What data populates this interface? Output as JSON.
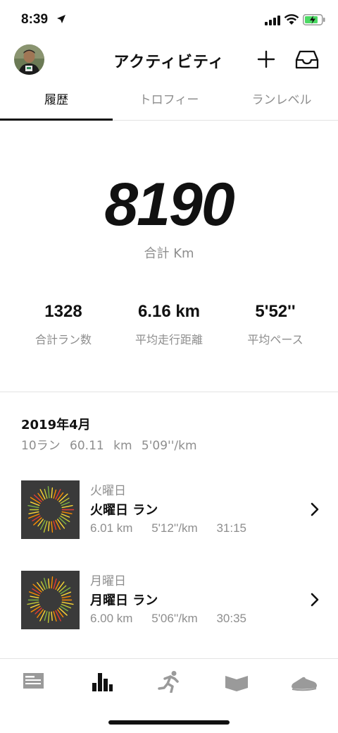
{
  "status": {
    "time": "8:39"
  },
  "header": {
    "title": "アクティビティ"
  },
  "tabs": [
    {
      "label": "履歴"
    },
    {
      "label": "トロフィー"
    },
    {
      "label": "ランレベル"
    }
  ],
  "summary": {
    "total_km": "8190",
    "total_label": "合計 Km",
    "stats": [
      {
        "value": "1328",
        "label": "合計ラン数"
      },
      {
        "value": "6.16 km",
        "label": "平均走行距離"
      },
      {
        "value": "5'52''",
        "label": "平均ペース"
      }
    ]
  },
  "month": {
    "title": "2019年4月",
    "summary": "10ラン 60.11 km 5'09''/km"
  },
  "runs": [
    {
      "day": "火曜日",
      "name": "火曜日 ラン",
      "distance": "6.01 km",
      "pace": "5'12''/km",
      "duration": "31:15"
    },
    {
      "day": "月曜日",
      "name": "月曜日 ラン",
      "distance": "6.00 km",
      "pace": "5'06''/km",
      "duration": "30:35"
    }
  ],
  "tabbar": {
    "items": [
      "feed-icon",
      "activity-chart-icon",
      "runner-icon",
      "plans-icon",
      "shoe-icon"
    ],
    "active": "activity-chart-icon"
  },
  "colors": {
    "inactive": "#8e8e8e",
    "active": "#111111",
    "thumb_bg": "#3a3a3a"
  }
}
